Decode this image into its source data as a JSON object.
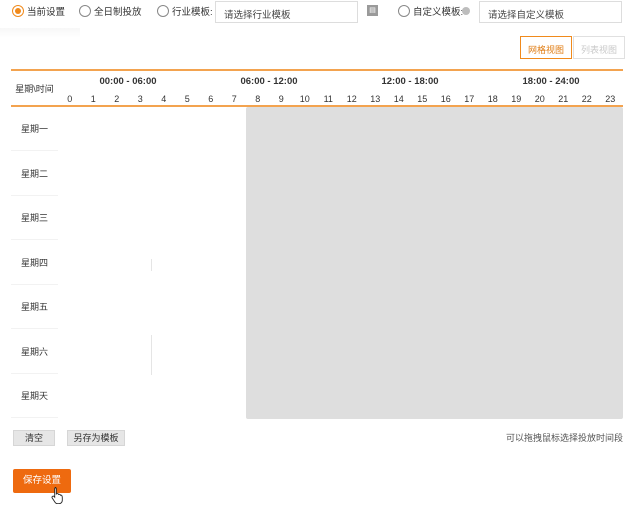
{
  "options": {
    "current_setting": "当前设置",
    "all_day": "全日制投放",
    "industry_template": "行业模板:",
    "industry_select_placeholder": "请选择行业模板",
    "custom_template": "自定义模板:",
    "custom_select_placeholder": "请选择自定义模板",
    "save_template_icon": "save-template-icon",
    "selected": "current_setting"
  },
  "view_toggle": {
    "grid_view": "网格视图",
    "list_view": "列表视图",
    "active": "grid_view"
  },
  "schedule": {
    "corner_label": "星期\\时间",
    "ranges": [
      "00:00 - 06:00",
      "06:00 - 12:00",
      "12:00 - 18:00",
      "18:00 - 24:00"
    ],
    "hours": [
      "0",
      "1",
      "2",
      "3",
      "4",
      "5",
      "6",
      "7",
      "8",
      "9",
      "10",
      "11",
      "12",
      "13",
      "14",
      "15",
      "16",
      "17",
      "18",
      "19",
      "20",
      "21",
      "22",
      "23"
    ],
    "days": [
      "星期一",
      "星期二",
      "星期三",
      "星期四",
      "星期五",
      "星期六",
      "星期天"
    ],
    "selected_hours": {
      "from": 10,
      "to": 23
    }
  },
  "actions": {
    "clear": "清空",
    "save_as_template": "另存为模板",
    "hint": "可以拖拽鼠标选择投放时间段",
    "save_settings": "保存设置"
  },
  "colors": {
    "accent": "#f08a1c",
    "primary_button": "#ee6a0f",
    "selected_cell": "#dedede"
  }
}
